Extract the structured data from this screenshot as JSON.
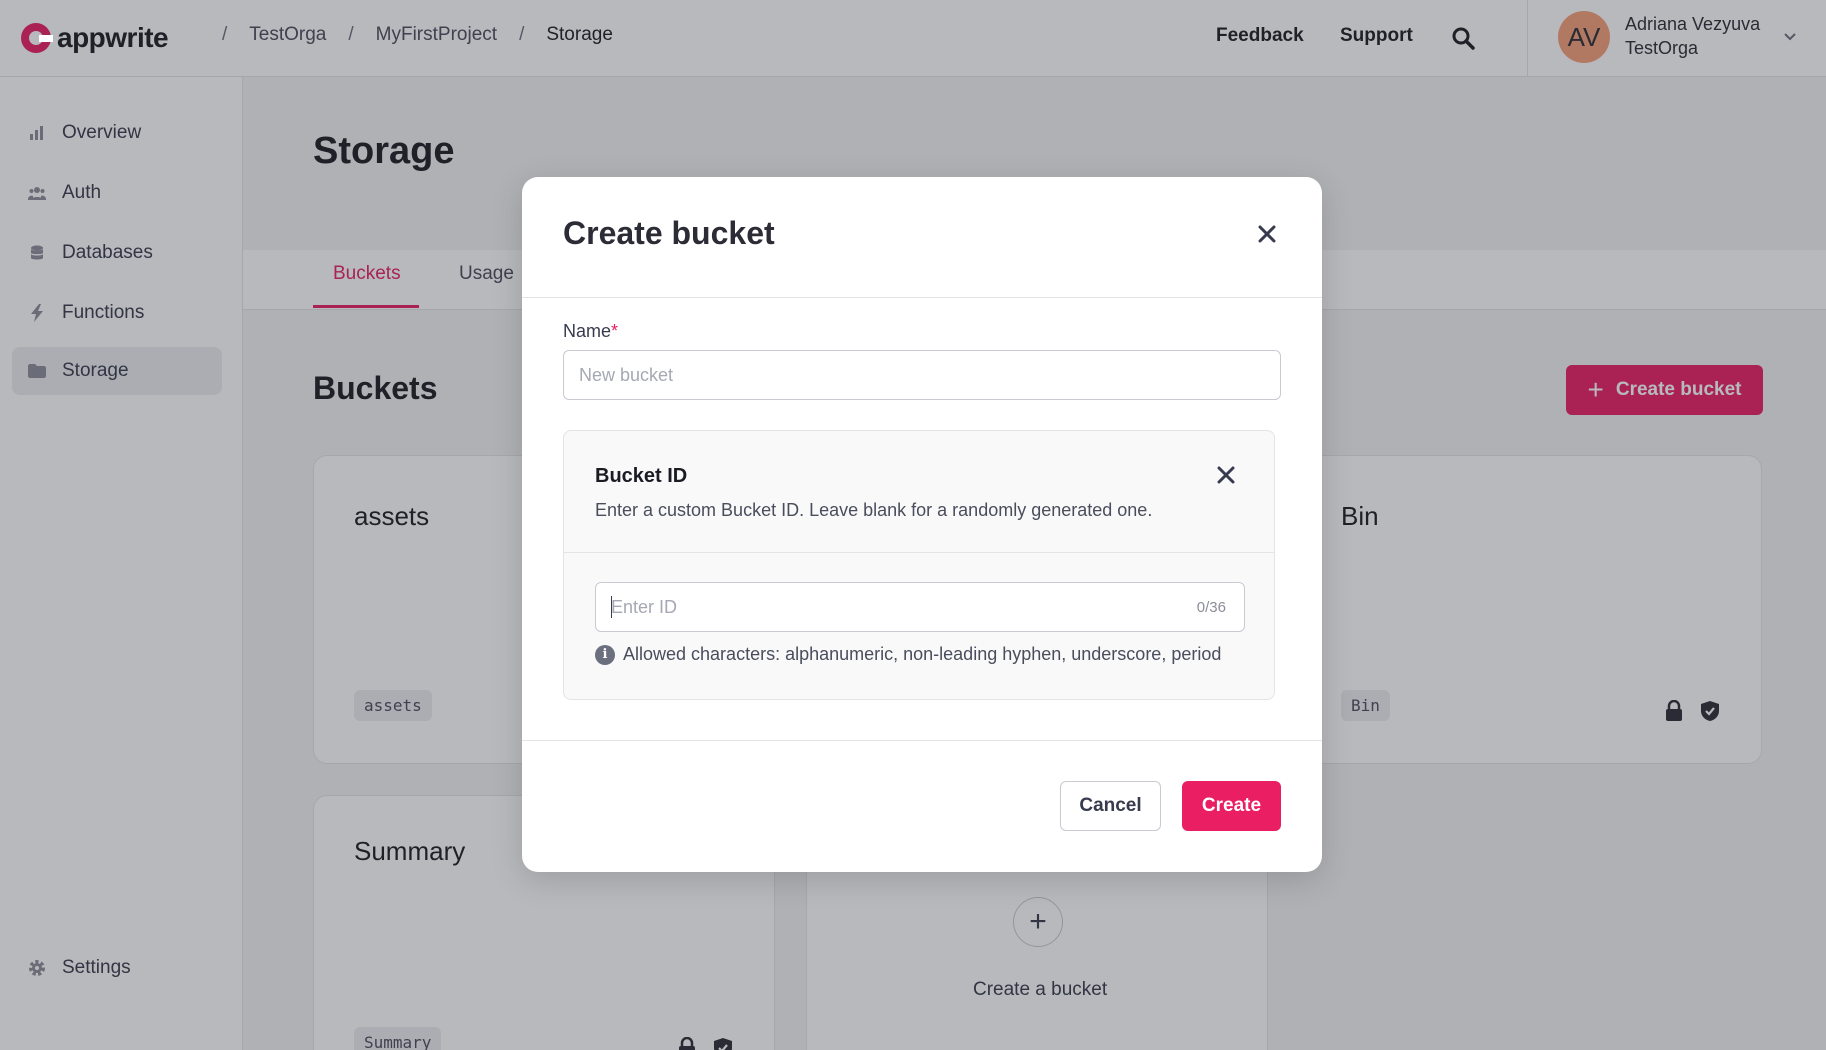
{
  "header": {
    "logo_text": "appwrite",
    "breadcrumb": [
      "TestOrga",
      "MyFirstProject",
      "Storage"
    ],
    "separator": "/",
    "feedback_label": "Feedback",
    "support_label": "Support",
    "user": {
      "initials": "AV",
      "name": "Adriana Vezyuva",
      "org": "TestOrga"
    }
  },
  "sidebar": {
    "items": [
      {
        "label": "Overview",
        "icon": "bar-chart-icon"
      },
      {
        "label": "Auth",
        "icon": "users-icon"
      },
      {
        "label": "Databases",
        "icon": "database-icon"
      },
      {
        "label": "Functions",
        "icon": "lightning-icon"
      },
      {
        "label": "Storage",
        "icon": "folder-icon",
        "active": true
      }
    ],
    "settings_label": "Settings"
  },
  "main": {
    "title": "Storage",
    "tabs": [
      {
        "label": "Buckets",
        "active": true
      },
      {
        "label": "Usage"
      }
    ],
    "section_title": "Buckets",
    "create_bucket_label": "Create bucket",
    "buckets": [
      {
        "name": "assets",
        "id": "assets"
      },
      {
        "name": "Bin",
        "id": "Bin"
      },
      {
        "name": "Summary",
        "id": "Summary"
      }
    ],
    "create_card_label": "Create a bucket"
  },
  "modal": {
    "title": "Create bucket",
    "name_label": "Name",
    "name_required_mark": "*",
    "name_placeholder": "New bucket",
    "id_title": "Bucket ID",
    "id_description": "Enter a custom Bucket ID. Leave blank for a randomly generated one.",
    "id_placeholder": "Enter ID",
    "id_counter": "0/36",
    "id_hint": "Allowed characters: alphanumeric, non-leading hyphen, underscore, period",
    "cancel_label": "Cancel",
    "create_label": "Create"
  },
  "colors": {
    "accent": "#e91e63",
    "avatar": "#f6a07a"
  }
}
